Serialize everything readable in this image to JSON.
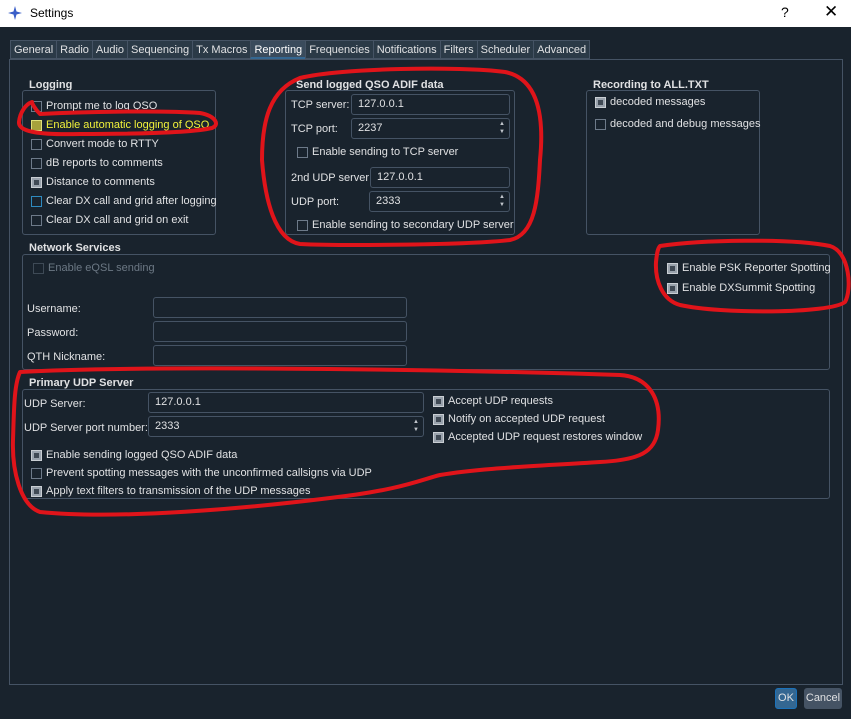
{
  "window": {
    "title": "Settings",
    "help_glyph": "?",
    "close_glyph": "✕"
  },
  "tabs": [
    {
      "label": "General"
    },
    {
      "label": "Radio"
    },
    {
      "label": "Audio"
    },
    {
      "label": "Sequencing"
    },
    {
      "label": "Tx Macros"
    },
    {
      "label": "Reporting"
    },
    {
      "label": "Frequencies"
    },
    {
      "label": "Notifications"
    },
    {
      "label": "Filters"
    },
    {
      "label": "Scheduler"
    },
    {
      "label": "Advanced"
    }
  ],
  "active_tab": "Reporting",
  "logging": {
    "title": "Logging",
    "items": [
      {
        "label": "Prompt me to log QSO",
        "checked": false
      },
      {
        "label": "Enable automatic logging of QSO",
        "checked": true
      },
      {
        "label": "Convert mode to RTTY",
        "checked": false
      },
      {
        "label": "dB reports to comments",
        "checked": false
      },
      {
        "label": "Distance to comments",
        "checked": true
      },
      {
        "label": "Clear DX call and grid after logging",
        "checked": false
      },
      {
        "label": "Clear DX call and grid on exit",
        "checked": false
      }
    ]
  },
  "adif": {
    "title": "Send logged QSO ADIF data",
    "tcp_server_label": "TCP server:",
    "tcp_server": "127.0.0.1",
    "tcp_port_label": "TCP port:",
    "tcp_port": "2237",
    "enable_tcp": "Enable sending to TCP server",
    "udp2_server_label": "2nd UDP server",
    "udp2_server": "127.0.0.1",
    "udp_port_label": "UDP port:",
    "udp_port": "2333",
    "enable_udp2": "Enable sending to secondary UDP server"
  },
  "recording": {
    "title": "Recording to ALL.TXT",
    "decoded": "decoded messages",
    "decoded_debug": "decoded and debug messages"
  },
  "network": {
    "title": "Network Services",
    "eqsl": "Enable eQSL sending",
    "psk": "Enable PSK Reporter Spotting",
    "dxsummit": "Enable DXSummit Spotting",
    "username_label": "Username:",
    "password_label": "Password:",
    "qth_label": "QTH Nickname:"
  },
  "primary_udp": {
    "title": "Primary UDP Server",
    "server_label": "UDP Server:",
    "server": "127.0.0.1",
    "port_label": "UDP Server port number:",
    "port": "2333",
    "accept": "Accept UDP requests",
    "notify": "Notify on accepted UDP request",
    "restores": "Accepted UDP request restores window",
    "enable_adif": "Enable sending logged QSO ADIF data",
    "prevent": "Prevent spotting messages with the unconfirmed callsigns via UDP",
    "filters": "Apply text filters to transmission of the UDP messages"
  },
  "buttons": {
    "ok": "OK",
    "cancel": "Cancel"
  },
  "colors": {
    "annotation_red": "#e0141a",
    "background": "#19232d",
    "highlight_yellow": "#f2f23a"
  }
}
